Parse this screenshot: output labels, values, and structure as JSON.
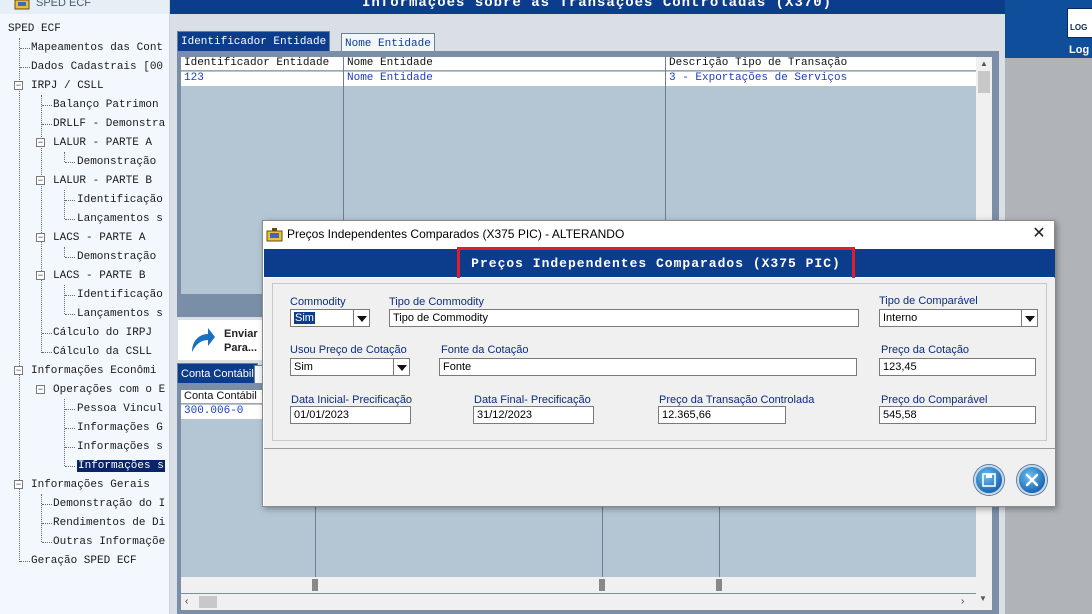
{
  "tree": {
    "title": "SPED ECF",
    "items": [
      {
        "label": "SPED ECF"
      },
      {
        "label": "Mapeamentos das Cont"
      },
      {
        "label": "Dados Cadastrais [00"
      },
      {
        "label": "IRPJ / CSLL"
      },
      {
        "label": "Balanço Patrimon"
      },
      {
        "label": "DRLLF - Demonstra"
      },
      {
        "label": "LALUR - PARTE A"
      },
      {
        "label": "Demonstração"
      },
      {
        "label": "LALUR - PARTE B"
      },
      {
        "label": "Identificação"
      },
      {
        "label": "Lançamentos s"
      },
      {
        "label": "LACS - PARTE A"
      },
      {
        "label": "Demonstração"
      },
      {
        "label": "LACS - PARTE B"
      },
      {
        "label": "Identificação"
      },
      {
        "label": "Lançamentos s"
      },
      {
        "label": "Cálculo do IRPJ"
      },
      {
        "label": "Cálculo da CSLL"
      },
      {
        "label": "Informações Econômi"
      },
      {
        "label": "Operações com o E"
      },
      {
        "label": "Pessoa Vincul"
      },
      {
        "label": "Informações G"
      },
      {
        "label": "Informações s"
      },
      {
        "label": "Informações s"
      },
      {
        "label": "Informações Gerais"
      },
      {
        "label": "Demonstração do I"
      },
      {
        "label": "Rendimentos de Di"
      },
      {
        "label": "Outras Informaçõe"
      },
      {
        "label": "Geração SPED ECF"
      }
    ]
  },
  "main": {
    "title": "Informações sobre as Transações Controladas (X370)",
    "tabs": [
      "Identificador Entidade",
      "Nome Entidade"
    ],
    "grid": {
      "headers": [
        "Identificador Entidade",
        "Nome Entidade",
        "Descrição Tipo de Transação"
      ],
      "rows": [
        [
          "123",
          "Nome Entidade",
          "3 - Exportações de Serviços"
        ]
      ]
    },
    "send_label": "Enviar",
    "send_label2": "Para...",
    "lower_tab": "Conta Contábil",
    "lower_grid": {
      "header": "Conta Contábil",
      "rows": [
        "300.006-0"
      ]
    }
  },
  "right": {
    "logo_label": "LOG",
    "label": "Log"
  },
  "dialog": {
    "window_title": "Preços Independentes Comparados (X375 PIC)   -   ALTERANDO",
    "banner_title": "Preços Independentes Comparados (X375 PIC)",
    "fields": {
      "commodity": {
        "label": "Commodity",
        "value": "Sim"
      },
      "tipo_commodity": {
        "label": "Tipo de Commodity",
        "value": "Tipo de Commodity"
      },
      "tipo_comparavel": {
        "label": "Tipo de Comparável",
        "value": "Interno"
      },
      "usou_preco": {
        "label": "Usou Preço de Cotação",
        "value": "Sim"
      },
      "fonte_cotacao": {
        "label": "Fonte da Cotação",
        "value": "Fonte"
      },
      "preco_cotacao": {
        "label": "Preço da Cotação",
        "value": "123,45"
      },
      "data_inicial": {
        "label": "Data Inicial- Precificação",
        "value": "01/01/2023"
      },
      "data_final": {
        "label": "Data Final- Precificação",
        "value": "31/12/2023"
      },
      "preco_transacao": {
        "label": "Preço da Transação Controlada",
        "value": "12.365,66"
      },
      "preco_comparavel": {
        "label": "Preço do Comparável",
        "value": "545,58"
      }
    }
  }
}
